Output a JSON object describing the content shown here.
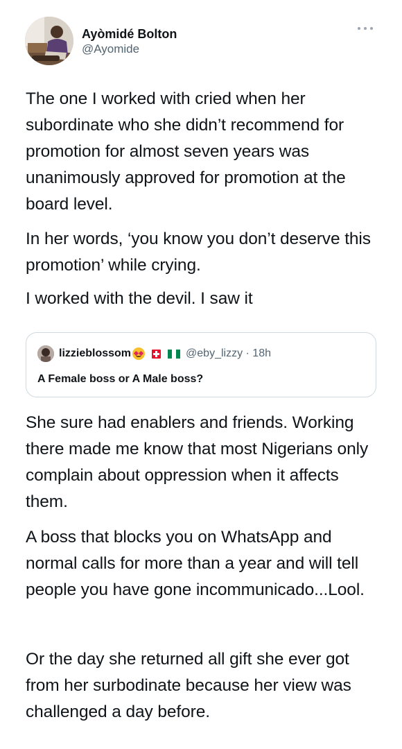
{
  "author": {
    "name": "Ayòmidé Bolton",
    "handle": "@Ayomide"
  },
  "tweet": {
    "paragraph_1": "The one I worked with cried when her subordinate who she didn’t recommend for promotion for almost seven years was unanimously approved for promotion at the board level.",
    "paragraph_2": "In her words, ‘you know you don’t deserve this promotion’ while crying.",
    "paragraph_3": "I worked with the devil. I saw it",
    "paragraph_4": "She sure had enablers and friends. Working there made me know that most Nigerians only complain about oppression when it affects them.",
    "paragraph_5": "A boss that blocks you on WhatsApp and normal calls for more than a year and will tell people you have gone incommunicado...Lool.",
    "paragraph_6": "Or the day she returned all gift she ever got from her surbodinate because her view was challenged a day before."
  },
  "quoted_tweet": {
    "name": "lizzieblossom",
    "handle_time": "@eby_lizzy · 18h",
    "text": "A Female boss or A Male boss?",
    "name_emoji": "smiling-face-with-heart-eyes",
    "flags": [
      "switzerland-flag",
      "nigeria-flag"
    ]
  },
  "icons": {
    "more": "more-options-icon"
  },
  "colors": {
    "text_primary": "#0f1419",
    "text_secondary": "#536471",
    "border": "#cfd9de",
    "nigeria_green": "#008751"
  }
}
